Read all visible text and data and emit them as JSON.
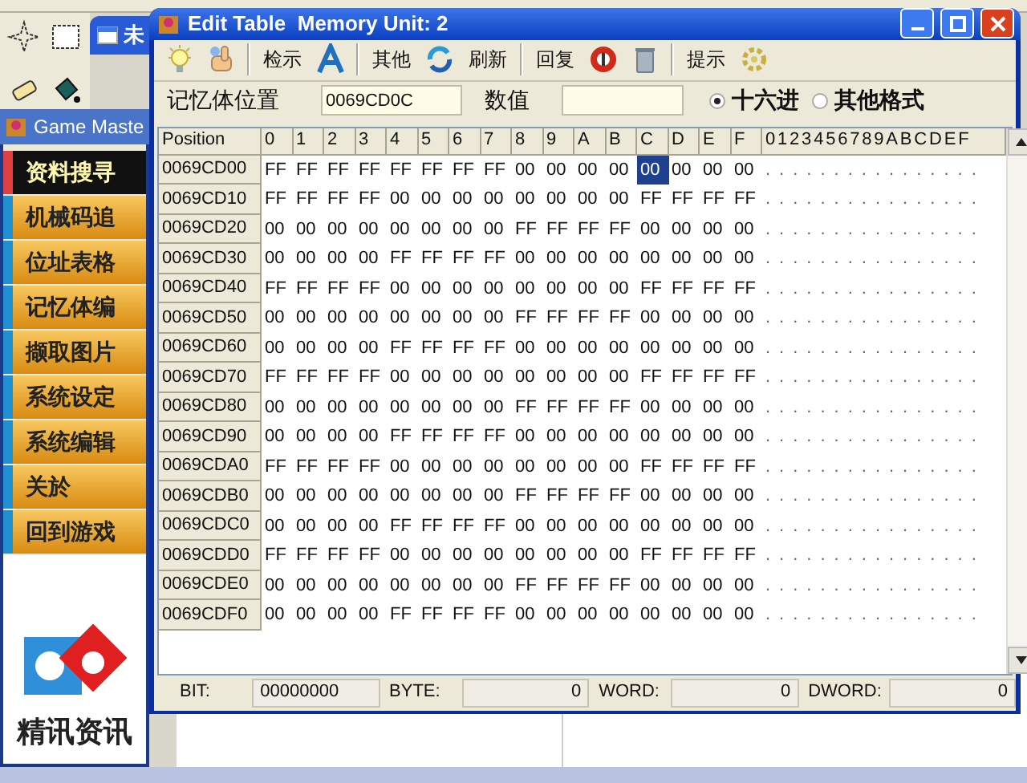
{
  "background_window": {
    "title": "未"
  },
  "game_master": {
    "title": "Game Maste",
    "menu": [
      {
        "label": "资料搜寻",
        "selected": true
      },
      {
        "label": "机械码追",
        "selected": false
      },
      {
        "label": "位址表格",
        "selected": false
      },
      {
        "label": "记忆体编",
        "selected": false
      },
      {
        "label": "撷取图片",
        "selected": false
      },
      {
        "label": "系统设定",
        "selected": false
      },
      {
        "label": "系统编辑",
        "selected": false
      },
      {
        "label": "关於",
        "selected": false
      },
      {
        "label": "回到游戏",
        "selected": false
      }
    ],
    "logo_caption": "精讯资讯"
  },
  "edit_window": {
    "title": "Edit Table  Memory Unit: 2",
    "toolbar": [
      {
        "kind": "icon"
      },
      {
        "kind": "icon"
      },
      {
        "kind": "sep"
      },
      {
        "kind": "text",
        "label": "检示"
      },
      {
        "kind": "icon"
      },
      {
        "kind": "sep"
      },
      {
        "kind": "text",
        "label": "其他"
      },
      {
        "kind": "icon"
      },
      {
        "kind": "text",
        "label": "刷新"
      },
      {
        "kind": "sep"
      },
      {
        "kind": "text",
        "label": "回复"
      },
      {
        "kind": "icon"
      },
      {
        "kind": "icon"
      },
      {
        "kind": "sep"
      },
      {
        "kind": "text",
        "label": "提示"
      },
      {
        "kind": "icon"
      }
    ],
    "address_label": "记忆体位置",
    "address_value": "0069CD0C",
    "value_label": "数值",
    "formats": [
      {
        "label": "十六进",
        "selected": true
      },
      {
        "label": "其他格式",
        "selected": false
      }
    ],
    "grid": {
      "position_header": "Position",
      "byte_headers": [
        "0",
        "1",
        "2",
        "3",
        "4",
        "5",
        "6",
        "7",
        "8",
        "9",
        "A",
        "B",
        "C",
        "D",
        "E",
        "F"
      ],
      "ascii_header": "0123456789ABCDEF",
      "rows": [
        {
          "position": "0069CD00",
          "bytes": [
            {
              "v": "FF",
              "selected": false
            },
            {
              "v": "FF",
              "selected": false
            },
            {
              "v": "FF",
              "selected": false
            },
            {
              "v": "FF",
              "selected": false
            },
            {
              "v": "FF",
              "selected": false
            },
            {
              "v": "FF",
              "selected": false
            },
            {
              "v": "FF",
              "selected": false
            },
            {
              "v": "FF",
              "selected": false
            },
            {
              "v": "00",
              "selected": false
            },
            {
              "v": "00",
              "selected": false
            },
            {
              "v": "00",
              "selected": false
            },
            {
              "v": "00",
              "selected": false
            },
            {
              "v": "00",
              "selected": true
            },
            {
              "v": "00",
              "selected": false
            },
            {
              "v": "00",
              "selected": false
            },
            {
              "v": "00",
              "selected": false
            }
          ],
          "ascii": "................"
        },
        {
          "position": "0069CD10",
          "bytes": [
            {
              "v": "FF",
              "selected": false
            },
            {
              "v": "FF",
              "selected": false
            },
            {
              "v": "FF",
              "selected": false
            },
            {
              "v": "FF",
              "selected": false
            },
            {
              "v": "00",
              "selected": false
            },
            {
              "v": "00",
              "selected": false
            },
            {
              "v": "00",
              "selected": false
            },
            {
              "v": "00",
              "selected": false
            },
            {
              "v": "00",
              "selected": false
            },
            {
              "v": "00",
              "selected": false
            },
            {
              "v": "00",
              "selected": false
            },
            {
              "v": "00",
              "selected": false
            },
            {
              "v": "FF",
              "selected": false
            },
            {
              "v": "FF",
              "selected": false
            },
            {
              "v": "FF",
              "selected": false
            },
            {
              "v": "FF",
              "selected": false
            }
          ],
          "ascii": "................"
        },
        {
          "position": "0069CD20",
          "bytes": [
            {
              "v": "00",
              "selected": false
            },
            {
              "v": "00",
              "selected": false
            },
            {
              "v": "00",
              "selected": false
            },
            {
              "v": "00",
              "selected": false
            },
            {
              "v": "00",
              "selected": false
            },
            {
              "v": "00",
              "selected": false
            },
            {
              "v": "00",
              "selected": false
            },
            {
              "v": "00",
              "selected": false
            },
            {
              "v": "FF",
              "selected": false
            },
            {
              "v": "FF",
              "selected": false
            },
            {
              "v": "FF",
              "selected": false
            },
            {
              "v": "FF",
              "selected": false
            },
            {
              "v": "00",
              "selected": false
            },
            {
              "v": "00",
              "selected": false
            },
            {
              "v": "00",
              "selected": false
            },
            {
              "v": "00",
              "selected": false
            }
          ],
          "ascii": "................"
        },
        {
          "position": "0069CD30",
          "bytes": [
            {
              "v": "00",
              "selected": false
            },
            {
              "v": "00",
              "selected": false
            },
            {
              "v": "00",
              "selected": false
            },
            {
              "v": "00",
              "selected": false
            },
            {
              "v": "FF",
              "selected": false
            },
            {
              "v": "FF",
              "selected": false
            },
            {
              "v": "FF",
              "selected": false
            },
            {
              "v": "FF",
              "selected": false
            },
            {
              "v": "00",
              "selected": false
            },
            {
              "v": "00",
              "selected": false
            },
            {
              "v": "00",
              "selected": false
            },
            {
              "v": "00",
              "selected": false
            },
            {
              "v": "00",
              "selected": false
            },
            {
              "v": "00",
              "selected": false
            },
            {
              "v": "00",
              "selected": false
            },
            {
              "v": "00",
              "selected": false
            }
          ],
          "ascii": "................"
        },
        {
          "position": "0069CD40",
          "bytes": [
            {
              "v": "FF",
              "selected": false
            },
            {
              "v": "FF",
              "selected": false
            },
            {
              "v": "FF",
              "selected": false
            },
            {
              "v": "FF",
              "selected": false
            },
            {
              "v": "00",
              "selected": false
            },
            {
              "v": "00",
              "selected": false
            },
            {
              "v": "00",
              "selected": false
            },
            {
              "v": "00",
              "selected": false
            },
            {
              "v": "00",
              "selected": false
            },
            {
              "v": "00",
              "selected": false
            },
            {
              "v": "00",
              "selected": false
            },
            {
              "v": "00",
              "selected": false
            },
            {
              "v": "FF",
              "selected": false
            },
            {
              "v": "FF",
              "selected": false
            },
            {
              "v": "FF",
              "selected": false
            },
            {
              "v": "FF",
              "selected": false
            }
          ],
          "ascii": "................"
        },
        {
          "position": "0069CD50",
          "bytes": [
            {
              "v": "00",
              "selected": false
            },
            {
              "v": "00",
              "selected": false
            },
            {
              "v": "00",
              "selected": false
            },
            {
              "v": "00",
              "selected": false
            },
            {
              "v": "00",
              "selected": false
            },
            {
              "v": "00",
              "selected": false
            },
            {
              "v": "00",
              "selected": false
            },
            {
              "v": "00",
              "selected": false
            },
            {
              "v": "FF",
              "selected": false
            },
            {
              "v": "FF",
              "selected": false
            },
            {
              "v": "FF",
              "selected": false
            },
            {
              "v": "FF",
              "selected": false
            },
            {
              "v": "00",
              "selected": false
            },
            {
              "v": "00",
              "selected": false
            },
            {
              "v": "00",
              "selected": false
            },
            {
              "v": "00",
              "selected": false
            }
          ],
          "ascii": "................"
        },
        {
          "position": "0069CD60",
          "bytes": [
            {
              "v": "00",
              "selected": false
            },
            {
              "v": "00",
              "selected": false
            },
            {
              "v": "00",
              "selected": false
            },
            {
              "v": "00",
              "selected": false
            },
            {
              "v": "FF",
              "selected": false
            },
            {
              "v": "FF",
              "selected": false
            },
            {
              "v": "FF",
              "selected": false
            },
            {
              "v": "FF",
              "selected": false
            },
            {
              "v": "00",
              "selected": false
            },
            {
              "v": "00",
              "selected": false
            },
            {
              "v": "00",
              "selected": false
            },
            {
              "v": "00",
              "selected": false
            },
            {
              "v": "00",
              "selected": false
            },
            {
              "v": "00",
              "selected": false
            },
            {
              "v": "00",
              "selected": false
            },
            {
              "v": "00",
              "selected": false
            }
          ],
          "ascii": "................"
        },
        {
          "position": "0069CD70",
          "bytes": [
            {
              "v": "FF",
              "selected": false
            },
            {
              "v": "FF",
              "selected": false
            },
            {
              "v": "FF",
              "selected": false
            },
            {
              "v": "FF",
              "selected": false
            },
            {
              "v": "00",
              "selected": false
            },
            {
              "v": "00",
              "selected": false
            },
            {
              "v": "00",
              "selected": false
            },
            {
              "v": "00",
              "selected": false
            },
            {
              "v": "00",
              "selected": false
            },
            {
              "v": "00",
              "selected": false
            },
            {
              "v": "00",
              "selected": false
            },
            {
              "v": "00",
              "selected": false
            },
            {
              "v": "FF",
              "selected": false
            },
            {
              "v": "FF",
              "selected": false
            },
            {
              "v": "FF",
              "selected": false
            },
            {
              "v": "FF",
              "selected": false
            }
          ],
          "ascii": "................"
        },
        {
          "position": "0069CD80",
          "bytes": [
            {
              "v": "00",
              "selected": false
            },
            {
              "v": "00",
              "selected": false
            },
            {
              "v": "00",
              "selected": false
            },
            {
              "v": "00",
              "selected": false
            },
            {
              "v": "00",
              "selected": false
            },
            {
              "v": "00",
              "selected": false
            },
            {
              "v": "00",
              "selected": false
            },
            {
              "v": "00",
              "selected": false
            },
            {
              "v": "FF",
              "selected": false
            },
            {
              "v": "FF",
              "selected": false
            },
            {
              "v": "FF",
              "selected": false
            },
            {
              "v": "FF",
              "selected": false
            },
            {
              "v": "00",
              "selected": false
            },
            {
              "v": "00",
              "selected": false
            },
            {
              "v": "00",
              "selected": false
            },
            {
              "v": "00",
              "selected": false
            }
          ],
          "ascii": "................"
        },
        {
          "position": "0069CD90",
          "bytes": [
            {
              "v": "00",
              "selected": false
            },
            {
              "v": "00",
              "selected": false
            },
            {
              "v": "00",
              "selected": false
            },
            {
              "v": "00",
              "selected": false
            },
            {
              "v": "FF",
              "selected": false
            },
            {
              "v": "FF",
              "selected": false
            },
            {
              "v": "FF",
              "selected": false
            },
            {
              "v": "FF",
              "selected": false
            },
            {
              "v": "00",
              "selected": false
            },
            {
              "v": "00",
              "selected": false
            },
            {
              "v": "00",
              "selected": false
            },
            {
              "v": "00",
              "selected": false
            },
            {
              "v": "00",
              "selected": false
            },
            {
              "v": "00",
              "selected": false
            },
            {
              "v": "00",
              "selected": false
            },
            {
              "v": "00",
              "selected": false
            }
          ],
          "ascii": "................"
        },
        {
          "position": "0069CDA0",
          "bytes": [
            {
              "v": "FF",
              "selected": false
            },
            {
              "v": "FF",
              "selected": false
            },
            {
              "v": "FF",
              "selected": false
            },
            {
              "v": "FF",
              "selected": false
            },
            {
              "v": "00",
              "selected": false
            },
            {
              "v": "00",
              "selected": false
            },
            {
              "v": "00",
              "selected": false
            },
            {
              "v": "00",
              "selected": false
            },
            {
              "v": "00",
              "selected": false
            },
            {
              "v": "00",
              "selected": false
            },
            {
              "v": "00",
              "selected": false
            },
            {
              "v": "00",
              "selected": false
            },
            {
              "v": "FF",
              "selected": false
            },
            {
              "v": "FF",
              "selected": false
            },
            {
              "v": "FF",
              "selected": false
            },
            {
              "v": "FF",
              "selected": false
            }
          ],
          "ascii": "................"
        },
        {
          "position": "0069CDB0",
          "bytes": [
            {
              "v": "00",
              "selected": false
            },
            {
              "v": "00",
              "selected": false
            },
            {
              "v": "00",
              "selected": false
            },
            {
              "v": "00",
              "selected": false
            },
            {
              "v": "00",
              "selected": false
            },
            {
              "v": "00",
              "selected": false
            },
            {
              "v": "00",
              "selected": false
            },
            {
              "v": "00",
              "selected": false
            },
            {
              "v": "FF",
              "selected": false
            },
            {
              "v": "FF",
              "selected": false
            },
            {
              "v": "FF",
              "selected": false
            },
            {
              "v": "FF",
              "selected": false
            },
            {
              "v": "00",
              "selected": false
            },
            {
              "v": "00",
              "selected": false
            },
            {
              "v": "00",
              "selected": false
            },
            {
              "v": "00",
              "selected": false
            }
          ],
          "ascii": "................"
        },
        {
          "position": "0069CDC0",
          "bytes": [
            {
              "v": "00",
              "selected": false
            },
            {
              "v": "00",
              "selected": false
            },
            {
              "v": "00",
              "selected": false
            },
            {
              "v": "00",
              "selected": false
            },
            {
              "v": "FF",
              "selected": false
            },
            {
              "v": "FF",
              "selected": false
            },
            {
              "v": "FF",
              "selected": false
            },
            {
              "v": "FF",
              "selected": false
            },
            {
              "v": "00",
              "selected": false
            },
            {
              "v": "00",
              "selected": false
            },
            {
              "v": "00",
              "selected": false
            },
            {
              "v": "00",
              "selected": false
            },
            {
              "v": "00",
              "selected": false
            },
            {
              "v": "00",
              "selected": false
            },
            {
              "v": "00",
              "selected": false
            },
            {
              "v": "00",
              "selected": false
            }
          ],
          "ascii": "................"
        },
        {
          "position": "0069CDD0",
          "bytes": [
            {
              "v": "FF",
              "selected": false
            },
            {
              "v": "FF",
              "selected": false
            },
            {
              "v": "FF",
              "selected": false
            },
            {
              "v": "FF",
              "selected": false
            },
            {
              "v": "00",
              "selected": false
            },
            {
              "v": "00",
              "selected": false
            },
            {
              "v": "00",
              "selected": false
            },
            {
              "v": "00",
              "selected": false
            },
            {
              "v": "00",
              "selected": false
            },
            {
              "v": "00",
              "selected": false
            },
            {
              "v": "00",
              "selected": false
            },
            {
              "v": "00",
              "selected": false
            },
            {
              "v": "FF",
              "selected": false
            },
            {
              "v": "FF",
              "selected": false
            },
            {
              "v": "FF",
              "selected": false
            },
            {
              "v": "FF",
              "selected": false
            }
          ],
          "ascii": "................"
        },
        {
          "position": "0069CDE0",
          "bytes": [
            {
              "v": "00",
              "selected": false
            },
            {
              "v": "00",
              "selected": false
            },
            {
              "v": "00",
              "selected": false
            },
            {
              "v": "00",
              "selected": false
            },
            {
              "v": "00",
              "selected": false
            },
            {
              "v": "00",
              "selected": false
            },
            {
              "v": "00",
              "selected": false
            },
            {
              "v": "00",
              "selected": false
            },
            {
              "v": "FF",
              "selected": false
            },
            {
              "v": "FF",
              "selected": false
            },
            {
              "v": "FF",
              "selected": false
            },
            {
              "v": "FF",
              "selected": false
            },
            {
              "v": "00",
              "selected": false
            },
            {
              "v": "00",
              "selected": false
            },
            {
              "v": "00",
              "selected": false
            },
            {
              "v": "00",
              "selected": false
            }
          ],
          "ascii": "................"
        },
        {
          "position": "0069CDF0",
          "bytes": [
            {
              "v": "00",
              "selected": false
            },
            {
              "v": "00",
              "selected": false
            },
            {
              "v": "00",
              "selected": false
            },
            {
              "v": "00",
              "selected": false
            },
            {
              "v": "FF",
              "selected": false
            },
            {
              "v": "FF",
              "selected": false
            },
            {
              "v": "FF",
              "selected": false
            },
            {
              "v": "FF",
              "selected": false
            },
            {
              "v": "00",
              "selected": false
            },
            {
              "v": "00",
              "selected": false
            },
            {
              "v": "00",
              "selected": false
            },
            {
              "v": "00",
              "selected": false
            },
            {
              "v": "00",
              "selected": false
            },
            {
              "v": "00",
              "selected": false
            },
            {
              "v": "00",
              "selected": false
            },
            {
              "v": "00",
              "selected": false
            }
          ],
          "ascii": "................"
        }
      ]
    },
    "status": [
      {
        "label": "BIT:",
        "value": "00000000",
        "kind": "left"
      },
      {
        "label": "BYTE:",
        "value": "0",
        "kind": "right"
      },
      {
        "label": "WORD:",
        "value": "0",
        "kind": "right"
      },
      {
        "label": "DWORD:",
        "value": "0",
        "kind": "right"
      }
    ]
  }
}
